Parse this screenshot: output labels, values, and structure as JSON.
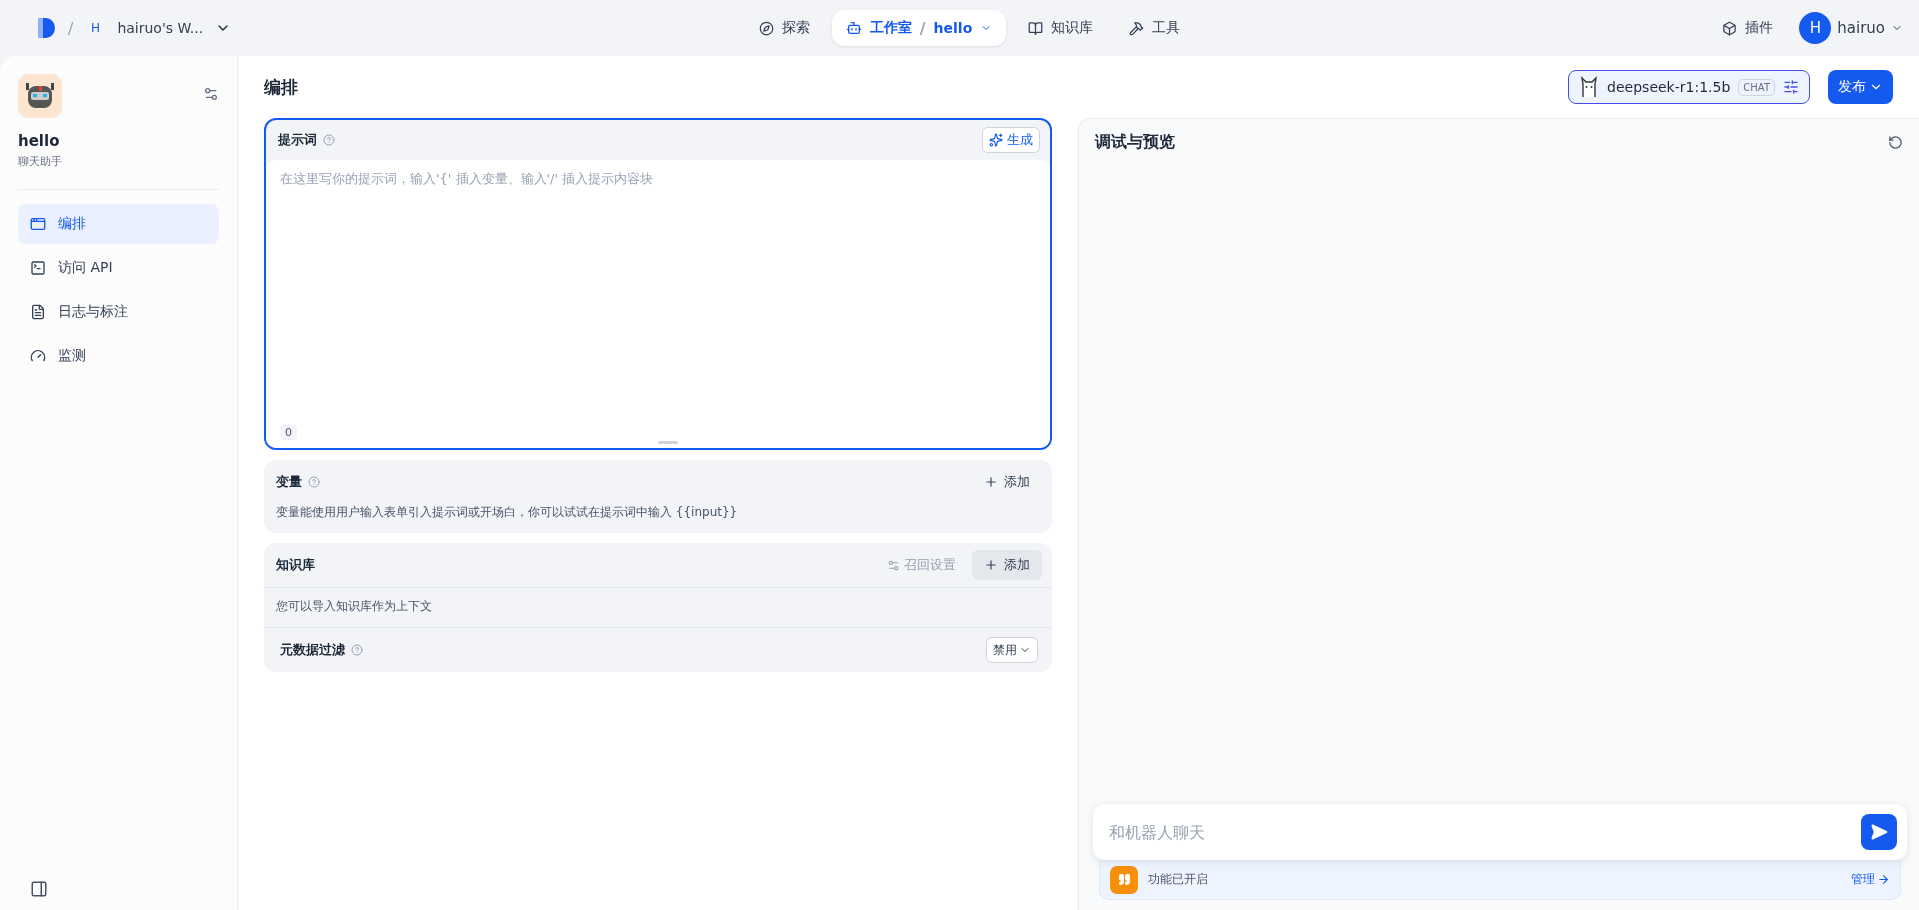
{
  "topbar": {
    "separator": "/",
    "workspace_initial": "H",
    "workspace": "hairuo's W...",
    "nav": [
      {
        "label": "探索",
        "kind": "explore",
        "selected": false
      },
      {
        "label": "工作室",
        "kind": "studio",
        "selected": true,
        "separator": "/",
        "app": "hello"
      },
      {
        "label": "知识库",
        "kind": "knowledge",
        "selected": false
      },
      {
        "label": "工具",
        "kind": "tools",
        "selected": false
      }
    ],
    "plugins": "插件",
    "user_initial": "H",
    "user": "hairuo"
  },
  "sidebar": {
    "app_name": "hello",
    "app_type": "聊天助手",
    "items": [
      {
        "label": "编排",
        "kind": "layout",
        "selected": true
      },
      {
        "label": "访问 API",
        "kind": "terminal",
        "selected": false
      },
      {
        "label": "日志与标注",
        "kind": "log",
        "selected": false
      },
      {
        "label": "监测",
        "kind": "gauge",
        "selected": false
      }
    ]
  },
  "header": {
    "title": "编排",
    "model": "deepseek-r1:1.5b",
    "model_tag": "CHAT",
    "publish": "发布"
  },
  "prompt": {
    "title": "提示词",
    "generate": "生成",
    "placeholder": "在这里写你的提示词，输入'{' 插入变量、输入'/' 插入提示内容块",
    "count": "0"
  },
  "variables": {
    "title": "变量",
    "add": "添加",
    "hint": "变量能使用用户输入表单引入提示词或开场白，你可以试试在提示词中输入 {{input}}"
  },
  "knowledge": {
    "title": "知识库",
    "retrieval": "召回设置",
    "add": "添加",
    "hint": "您可以导入知识库作为上下文",
    "filter_label": "元数据过滤",
    "filter_value": "禁用"
  },
  "preview": {
    "title": "调试与预览",
    "chat_placeholder": "和机器人聊天",
    "features": "功能已开启",
    "manage": "管理"
  }
}
